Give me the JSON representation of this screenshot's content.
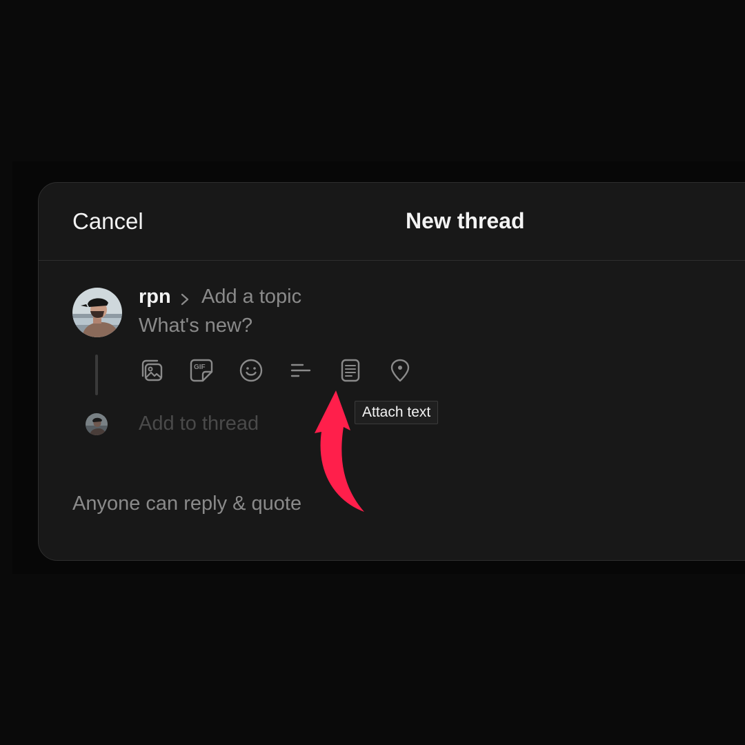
{
  "header": {
    "cancel_label": "Cancel",
    "title": "New thread"
  },
  "composer": {
    "username": "rpn",
    "topic_placeholder": "Add a topic",
    "body_placeholder": "What's new?",
    "add_to_thread_placeholder": "Add to thread"
  },
  "toolbar": {
    "icons": [
      "image-icon",
      "gif-icon",
      "emoji-icon",
      "poll-icon",
      "attach-text-icon",
      "location-icon"
    ],
    "gif_badge": "GIF"
  },
  "tooltip": {
    "text": "Attach text"
  },
  "footer": {
    "reply_setting": "Anyone can reply & quote"
  },
  "colors": {
    "background": "#0a0a0a",
    "dialog": "#181818",
    "primary_text": "#f3f3f3",
    "secondary_text": "#8a8a8a",
    "muted_text": "#4a4a4a",
    "accent_arrow": "#ff1f4b"
  }
}
